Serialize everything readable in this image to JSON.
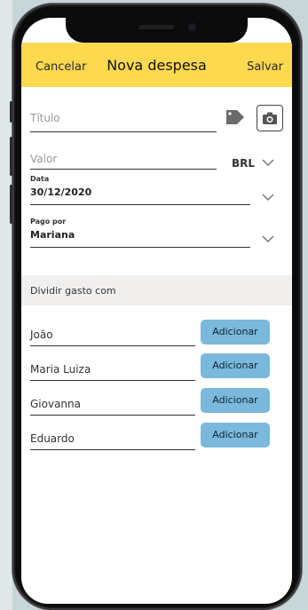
{
  "header": {
    "cancel_label": "Cancelar",
    "title": "Nova despesa",
    "save_label": "Salvar"
  },
  "form": {
    "title_placeholder": "Título",
    "value_placeholder": "Valor",
    "currency": "BRL",
    "date_label": "Data",
    "date_value": "30/12/2020",
    "paid_by_label": "Pago por",
    "paid_by_value": "Mariana"
  },
  "split": {
    "section_label": "Dividir gasto com",
    "people": [
      {
        "name": "João",
        "button": "Adicionar"
      },
      {
        "name": "Maria Luiza",
        "button": "Adicionar"
      },
      {
        "name": "Giovanna",
        "button": "Adicionar"
      },
      {
        "name": "Eduardo",
        "button": "Adicionar"
      }
    ]
  },
  "icons": {
    "tag": "tag-icon",
    "camera": "camera-icon",
    "chevron": "chevron-down-icon"
  },
  "colors": {
    "header": "#fdd94f",
    "button": "#7ab9dc",
    "section": "#f1eeee"
  }
}
